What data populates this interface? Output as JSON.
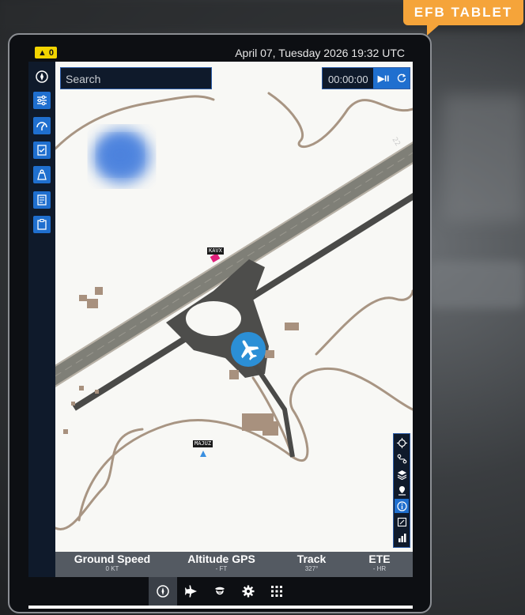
{
  "badge": {
    "label": "EFB TABLET"
  },
  "topbar": {
    "alert_count": "0",
    "datetime": "April 07, Tuesday 2026 19:32 UTC"
  },
  "search": {
    "placeholder": "Search"
  },
  "timer": {
    "time": "00:00:00",
    "play_pause": "▶II"
  },
  "sidebar": {
    "items": [
      {
        "icon": "compass-icon"
      },
      {
        "icon": "sliders-icon"
      },
      {
        "icon": "gauge-icon"
      },
      {
        "icon": "checklist-icon"
      },
      {
        "icon": "weight-icon"
      },
      {
        "icon": "document-icon"
      },
      {
        "icon": "clipboard-icon"
      }
    ]
  },
  "map": {
    "airport_label": "KAVX",
    "waypoint_label": "MAJUZ",
    "runway_number": "22"
  },
  "map_tools": [
    "crosshair-icon",
    "route-icon",
    "layers-icon",
    "pin-icon",
    "info-icon",
    "resize-icon",
    "chart-icon"
  ],
  "infobar": {
    "ground_speed": {
      "label": "Ground Speed",
      "value": "0 KT"
    },
    "altitude": {
      "label": "Altitude GPS",
      "value": "- FT"
    },
    "track": {
      "label": "Track",
      "value": "327°"
    },
    "ete": {
      "label": "ETE",
      "value": "- HR"
    }
  },
  "bottomnav": [
    "compass-icon",
    "airplane-icon",
    "pilot-icon",
    "gear-icon",
    "apps-grid-icon"
  ],
  "colors": {
    "accent": "#1f6fcf",
    "badge": "#f5a43a",
    "alert": "#f2d400",
    "aircraft": "#2b8fd6"
  }
}
